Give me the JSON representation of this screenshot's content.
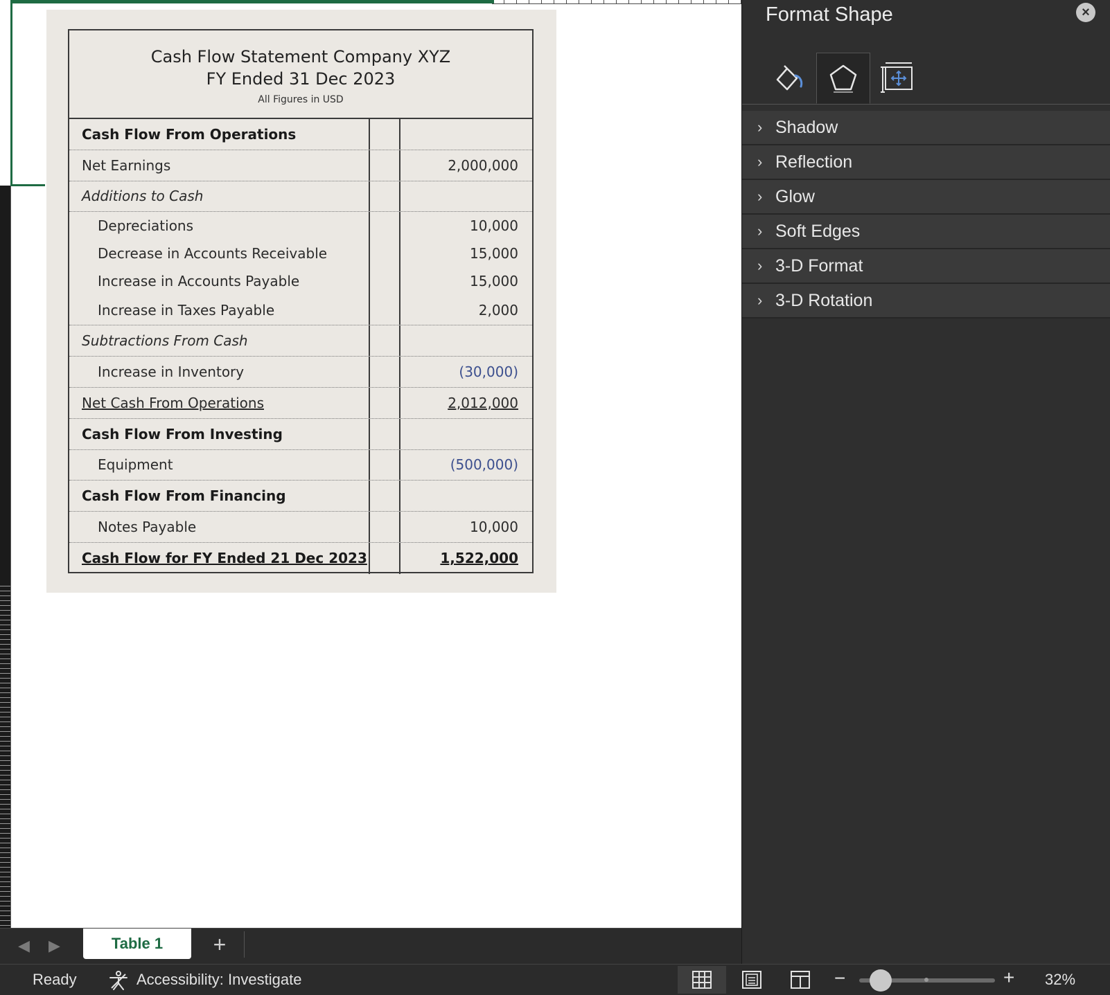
{
  "statement": {
    "title": "Cash Flow Statement Company XYZ",
    "subtitle": "FY Ended 31 Dec 2023",
    "units": "All Figures in USD",
    "rows": [
      {
        "label": "Cash Flow From Operations",
        "value": ""
      },
      {
        "label": "Net Earnings",
        "value": "2,000,000"
      },
      {
        "label": "Additions to Cash",
        "value": ""
      },
      {
        "label": "Depreciations",
        "value": "10,000"
      },
      {
        "label": "Decrease in Accounts Receivable",
        "value": "15,000"
      },
      {
        "label": "Increase in Accounts Payable",
        "value": "15,000"
      },
      {
        "label": "Increase in Taxes Payable",
        "value": "2,000"
      },
      {
        "label": "Subtractions From Cash",
        "value": ""
      },
      {
        "label": "Increase in Inventory",
        "value": "(30,000)"
      },
      {
        "label": "Net Cash From Operations",
        "value": "2,012,000"
      },
      {
        "label": "Cash Flow From Investing",
        "value": ""
      },
      {
        "label": "Equipment",
        "value": "(500,000)"
      },
      {
        "label": "Cash Flow From Financing",
        "value": ""
      },
      {
        "label": "Notes Payable",
        "value": "10,000"
      },
      {
        "label": "Cash Flow for FY Ended 21 Dec 2023",
        "value": "1,522,000"
      }
    ],
    "negative_color": "#3c4f8e"
  },
  "pane": {
    "title": "Format Shape",
    "close_icon": "close-circle-icon",
    "tabs": [
      "fill-line-icon",
      "effects-pentagon-icon",
      "size-properties-icon"
    ],
    "active_tab": 1,
    "sections": [
      "Shadow",
      "Reflection",
      "Glow",
      "Soft Edges",
      "3-D Format",
      "3-D Rotation"
    ]
  },
  "sheets": {
    "active": "Table 1",
    "add_label": "+"
  },
  "status": {
    "ready": "Ready",
    "accessibility": "Accessibility: Investigate",
    "zoom_minus": "−",
    "zoom_plus": "+",
    "zoom": "32%",
    "zoom_level_percent": 32
  },
  "colors": {
    "accent": "#1e6b43",
    "pane_bg": "#2f2f2f",
    "picture_bg": "#ebe8e3"
  }
}
